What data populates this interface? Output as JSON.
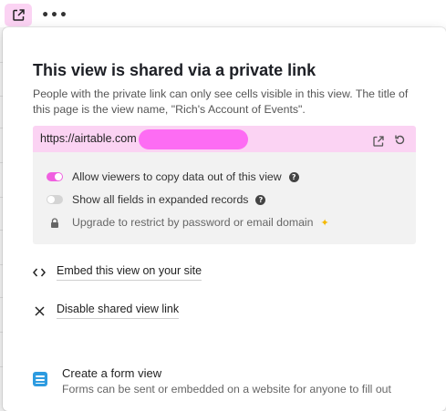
{
  "topbar": {
    "share_icon": "share-external-icon",
    "more_label": "•••"
  },
  "share_panel": {
    "title": "This view is shared via a private link",
    "description": "People with the private link can only see cells visible in this view. The title of this page is the view name, \"Rich's Account of Events\".",
    "link": {
      "url_visible": "https://airtable.com",
      "open_icon": "open-external-icon",
      "reset_icon": "regenerate-icon",
      "highlight_color": "#fbd3f3",
      "redaction_color": "#fd6cf3"
    },
    "options": [
      {
        "label": "Allow viewers to copy data out of this view",
        "enabled": true,
        "help": "?"
      },
      {
        "label": "Show all fields in expanded records",
        "enabled": false,
        "help": "?"
      },
      {
        "label": "Upgrade to restrict by password or email domain",
        "locked": true,
        "icon": "sparkle-icon"
      }
    ],
    "toggle_on_color": "#f060e0"
  },
  "actions": {
    "embed_label": "Embed this view on your site",
    "disable_label": "Disable shared view link"
  },
  "form_view": {
    "title": "Create a form view",
    "subtitle": "Forms can be sent or embedded on a website for anyone to fill out",
    "icon_color": "#2d9be0"
  }
}
